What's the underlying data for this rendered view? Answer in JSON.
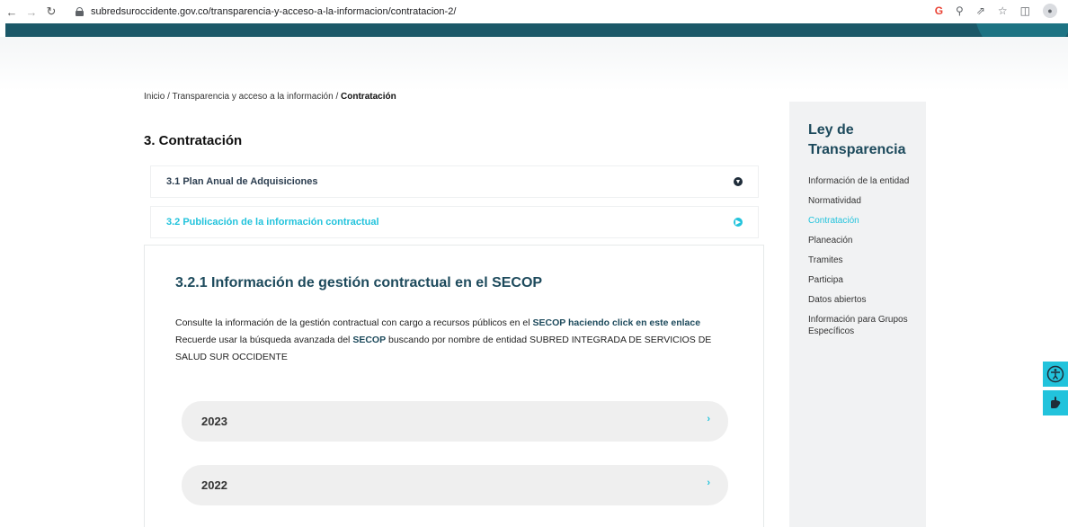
{
  "browser": {
    "url": "subredsuroccidente.gov.co/transparencia-y-acceso-a-la-informacion/contratacion-2/",
    "icons": [
      "back-icon",
      "forward-icon",
      "reload-icon",
      "lock-icon",
      "google-icon",
      "zoom-icon",
      "share-icon",
      "star-icon",
      "sidepanel-icon",
      "profile-icon"
    ]
  },
  "breadcrumb": {
    "home": "Inicio",
    "sep1": " / ",
    "section": "Transparencia y acceso a la información",
    "sep2": " / ",
    "current": "Contratación"
  },
  "main": {
    "title": "3. Contratación",
    "accordion": [
      {
        "label": "3.1 Plan Anual de Adquisiciones",
        "state": "collapsed"
      },
      {
        "label": "3.2 Publicación de la información contractual",
        "state": "expanded"
      }
    ],
    "section": {
      "title": "3.2.1 Información de gestión contractual en el SECOP",
      "p1_text": "Consulte la información de la gestión contractual con cargo a recursos públicos en el ",
      "p1_link": "SECOP haciendo click en este enlace",
      "p2_a": "Recuerde usar la búsqueda avanzada del ",
      "p2_b": "SECOP",
      "p2_c": " buscando por nombre de entidad SUBRED INTEGRADA DE SERVICIOS DE SALUD SUR OCCIDENTE"
    },
    "years": [
      {
        "label": "2023",
        "chevron": "›"
      },
      {
        "label": "2022",
        "chevron": "›"
      }
    ]
  },
  "sidebar": {
    "title": "Ley de Transparencia",
    "items": [
      {
        "label": "Información de la entidad"
      },
      {
        "label": "Normatividad"
      },
      {
        "label": "Contratación"
      },
      {
        "label": "Planeación"
      },
      {
        "label": "Tramites"
      },
      {
        "label": "Participa"
      },
      {
        "label": "Datos abiertos"
      },
      {
        "label": "Información para Grupos Específicos"
      }
    ]
  },
  "colors": {
    "primary_dark": "#1d4a5c",
    "accent": "#22c3dc",
    "header": "#1b5868",
    "sidebar_bg": "#f1f2f3",
    "row_bg": "#efefef"
  }
}
